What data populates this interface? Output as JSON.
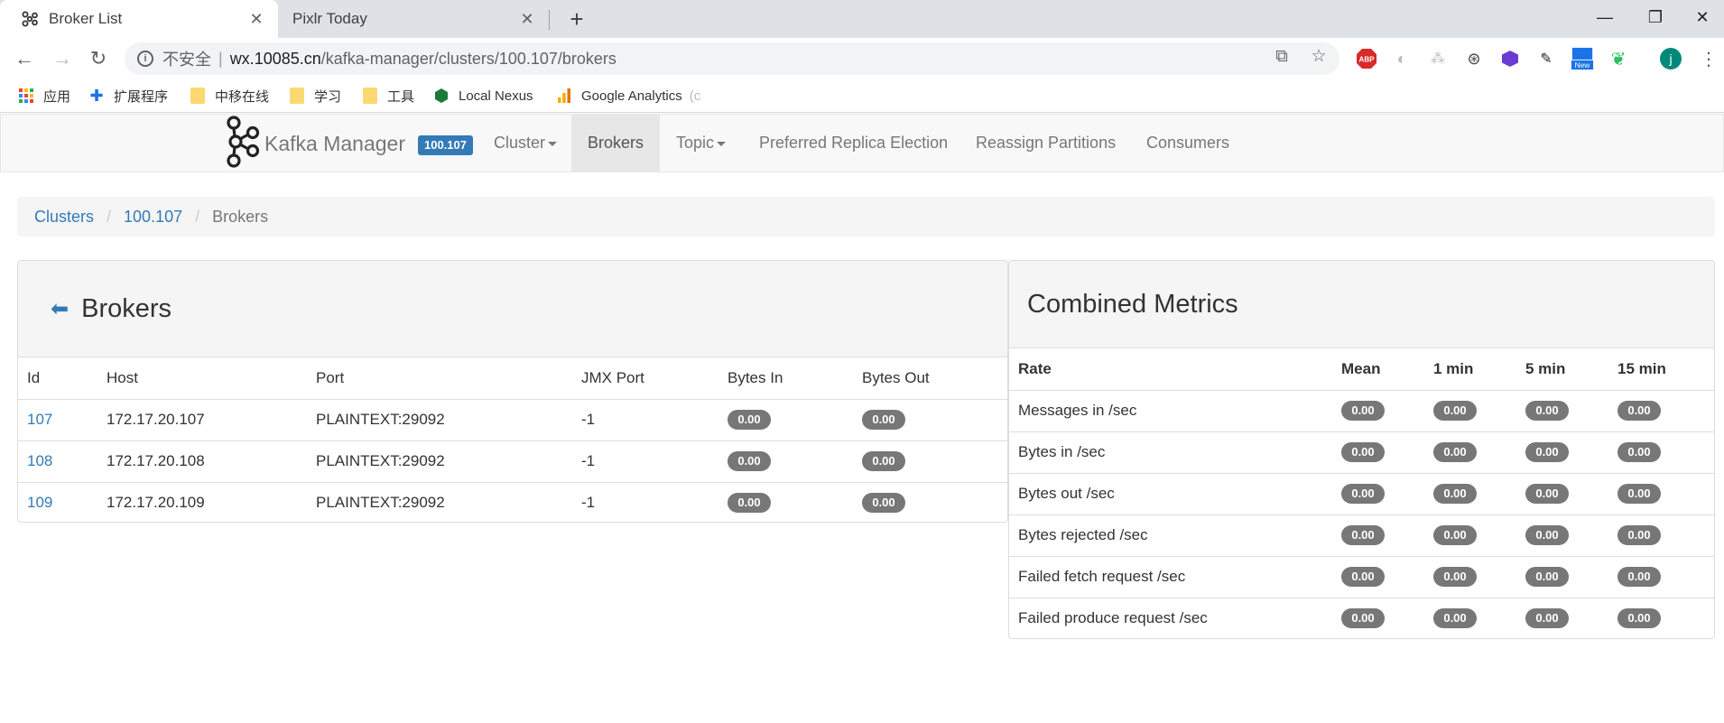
{
  "browser": {
    "tabs": [
      {
        "title": "Broker List",
        "active": true
      },
      {
        "title": "Pixlr Today",
        "active": false
      }
    ],
    "address": {
      "security": "不安全",
      "divider": "|",
      "host": "wx.10085.cn",
      "path": "/kafka-manager/clusters/100.107/brokers"
    },
    "extensions": [
      "ABP",
      "New"
    ],
    "profile_initial": "j",
    "bookmarks": [
      {
        "label": "应用",
        "icon": "apps-grid-icon"
      },
      {
        "label": "扩展程序",
        "icon": "puzzle-icon"
      },
      {
        "label": "中移在线",
        "icon": "folder-icon"
      },
      {
        "label": "学习",
        "icon": "folder-icon"
      },
      {
        "label": "工具",
        "icon": "folder-icon"
      },
      {
        "label": "Local Nexus",
        "icon": "nexus-icon"
      },
      {
        "label": "Google Analytics",
        "icon": "analytics-icon"
      }
    ],
    "bookmark_overflow": "(c"
  },
  "navbar": {
    "brand": "Kafka Manager",
    "cluster_badge": "100.107",
    "items": [
      {
        "label": "Cluster",
        "dropdown": true,
        "active": false
      },
      {
        "label": "Brokers",
        "dropdown": false,
        "active": true
      },
      {
        "label": "Topic",
        "dropdown": true,
        "active": false
      },
      {
        "label": "Preferred Replica Election",
        "dropdown": false,
        "active": false
      },
      {
        "label": "Reassign Partitions",
        "dropdown": false,
        "active": false
      },
      {
        "label": "Consumers",
        "dropdown": false,
        "active": false
      }
    ]
  },
  "breadcrumb": {
    "items": [
      "Clusters",
      "100.107"
    ],
    "current": "Brokers"
  },
  "brokers": {
    "title": "Brokers",
    "columns": [
      "Id",
      "Host",
      "Port",
      "JMX Port",
      "Bytes In",
      "Bytes Out"
    ],
    "rows": [
      {
        "id": "107",
        "host": "172.17.20.107",
        "port": "PLAINTEXT:29092",
        "jmx": "-1",
        "bytes_in": "0.00",
        "bytes_out": "0.00"
      },
      {
        "id": "108",
        "host": "172.17.20.108",
        "port": "PLAINTEXT:29092",
        "jmx": "-1",
        "bytes_in": "0.00",
        "bytes_out": "0.00"
      },
      {
        "id": "109",
        "host": "172.17.20.109",
        "port": "PLAINTEXT:29092",
        "jmx": "-1",
        "bytes_in": "0.00",
        "bytes_out": "0.00"
      }
    ]
  },
  "metrics": {
    "title": "Combined Metrics",
    "columns": [
      "Rate",
      "Mean",
      "1 min",
      "5 min",
      "15 min"
    ],
    "rows": [
      {
        "rate": "Messages in /sec",
        "mean": "0.00",
        "m1": "0.00",
        "m5": "0.00",
        "m15": "0.00"
      },
      {
        "rate": "Bytes in /sec",
        "mean": "0.00",
        "m1": "0.00",
        "m5": "0.00",
        "m15": "0.00"
      },
      {
        "rate": "Bytes out /sec",
        "mean": "0.00",
        "m1": "0.00",
        "m5": "0.00",
        "m15": "0.00"
      },
      {
        "rate": "Bytes rejected /sec",
        "mean": "0.00",
        "m1": "0.00",
        "m5": "0.00",
        "m15": "0.00"
      },
      {
        "rate": "Failed fetch request /sec",
        "mean": "0.00",
        "m1": "0.00",
        "m5": "0.00",
        "m15": "0.00"
      },
      {
        "rate": "Failed produce request /sec",
        "mean": "0.00",
        "m1": "0.00",
        "m5": "0.00",
        "m15": "0.00"
      }
    ]
  },
  "colors": {
    "link": "#337ab7",
    "badge_grey": "#777777",
    "navbar_bg": "#f8f8f8"
  }
}
